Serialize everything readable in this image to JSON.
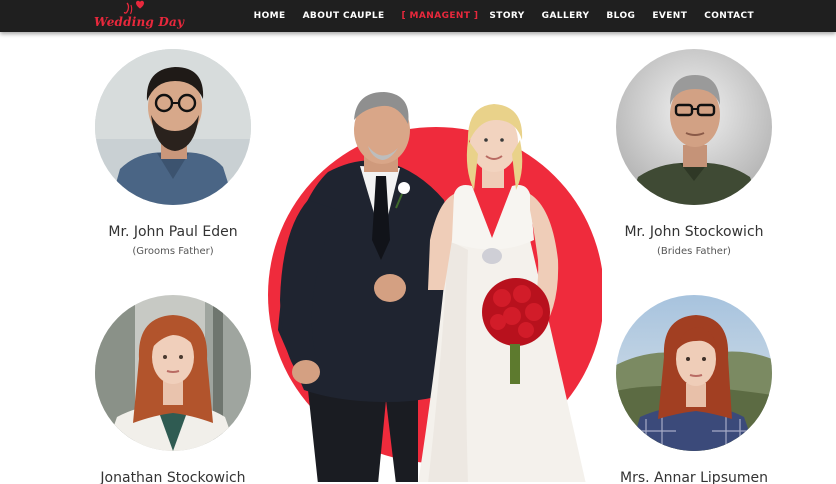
{
  "brand": {
    "logo_text": "Wedding Day",
    "accent_color": "#e8283c",
    "nav_bg": "#1f1f1f"
  },
  "nav": {
    "items": [
      {
        "label": "HOME",
        "active": false
      },
      {
        "label": "ABOUT CAUPLE",
        "active": false
      },
      {
        "label": "[ MANAGENT ]",
        "active": true
      },
      {
        "label": "STORY",
        "active": false
      },
      {
        "label": "GALLERY",
        "active": false
      },
      {
        "label": "BLOG",
        "active": false
      },
      {
        "label": "EVENT",
        "active": false
      },
      {
        "label": "CONTACT",
        "active": false
      }
    ]
  },
  "members": [
    {
      "name": "Mr. John Paul Eden",
      "role": "(Grooms Father)"
    },
    {
      "name": "Mr. John Stockowich",
      "role": "(Brides Father)"
    },
    {
      "name": "Jonathan Stockowich",
      "role": ""
    },
    {
      "name": "Mrs. Annar Lipsumen",
      "role": ""
    }
  ]
}
